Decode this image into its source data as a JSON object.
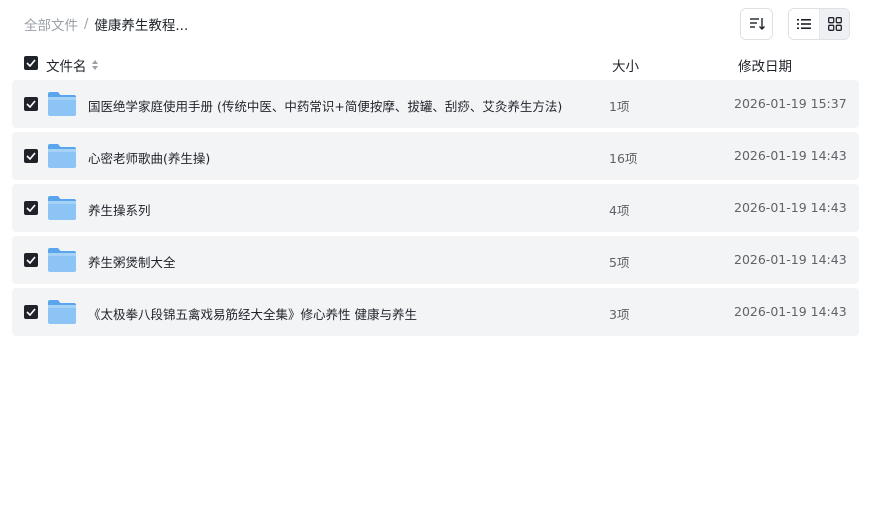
{
  "breadcrumb": {
    "root": "全部文件",
    "separator": "/",
    "current": "健康养生教程..."
  },
  "toolbar": {
    "sort_icon": "sort-lines-icon",
    "list_view_icon": "list-view-icon",
    "grid_view_icon": "grid-view-icon"
  },
  "table": {
    "headers": {
      "name": "文件名",
      "size": "大小",
      "date": "修改日期"
    },
    "rows": [
      {
        "name": "国医绝学家庭使用手册 (传统中医、中药常识+简便按摩、拔罐、刮痧、艾灸养生方法)",
        "count": "1项",
        "date": "2026-01-19 15:37"
      },
      {
        "name": "心密老师歌曲(养生操)",
        "count": "16项",
        "date": "2026-01-19 14:43"
      },
      {
        "name": "养生操系列",
        "count": "4项",
        "date": "2026-01-19 14:43"
      },
      {
        "name": "养生粥煲制大全",
        "count": "5项",
        "date": "2026-01-19 14:43"
      },
      {
        "name": "《太极拳八段锦五禽戏易筋经大全集》修心养性 健康与养生",
        "count": "3项",
        "date": "2026-01-19 14:43"
      }
    ]
  },
  "colors": {
    "row_bg": "#f3f4f6",
    "checkbox": "#1f2329",
    "folder": "#7ab8f0"
  }
}
